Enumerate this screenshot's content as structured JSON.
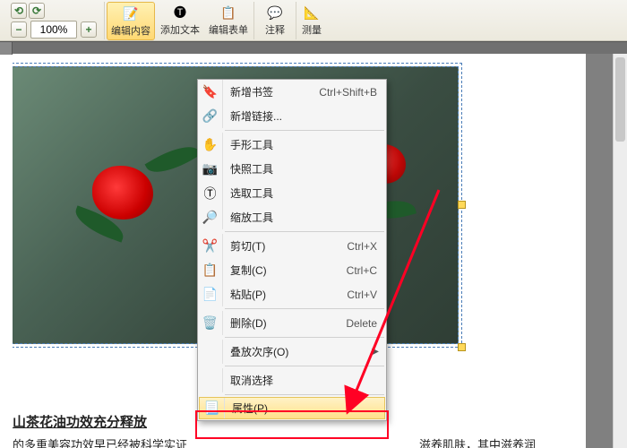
{
  "toolbar": {
    "zoom_value": "100%",
    "edit_content": "编辑内容",
    "add_text": "添加文本",
    "edit_form": "编辑表单",
    "annotate": "注释",
    "measure": "测量"
  },
  "context_menu": {
    "items": [
      {
        "label": "新增书签",
        "shortcut": "Ctrl+Shift+B",
        "icon": "bookmark"
      },
      {
        "label": "新增链接...",
        "shortcut": "",
        "icon": "link"
      },
      {
        "sep": true
      },
      {
        "label": "手形工具",
        "shortcut": "",
        "icon": "hand"
      },
      {
        "label": "快照工具",
        "shortcut": "",
        "icon": "camera"
      },
      {
        "label": "选取工具",
        "shortcut": "",
        "icon": "select"
      },
      {
        "label": "缩放工具",
        "shortcut": "",
        "icon": "zoom"
      },
      {
        "sep": true
      },
      {
        "label": "剪切(T)",
        "shortcut": "Ctrl+X",
        "icon": "cut"
      },
      {
        "label": "复制(C)",
        "shortcut": "Ctrl+C",
        "icon": "copy"
      },
      {
        "label": "粘贴(P)",
        "shortcut": "Ctrl+V",
        "icon": "paste"
      },
      {
        "sep": true
      },
      {
        "label": "删除(D)",
        "shortcut": "Delete",
        "icon": "delete"
      },
      {
        "sep": true
      },
      {
        "label": "叠放次序(O)",
        "shortcut": "",
        "icon": "",
        "sub": true
      },
      {
        "sep": true
      },
      {
        "label": "取消选择",
        "shortcut": "",
        "icon": ""
      },
      {
        "sep": true
      },
      {
        "label": "属性(P)...",
        "shortcut": "",
        "icon": "props",
        "hl": true
      }
    ]
  },
  "doc_text": {
    "line1": "山茶花油功效充分释放",
    "line2": "的多重美容功效早已经被科学实证",
    "line3": "滋养肌肤，其中滋养润"
  }
}
